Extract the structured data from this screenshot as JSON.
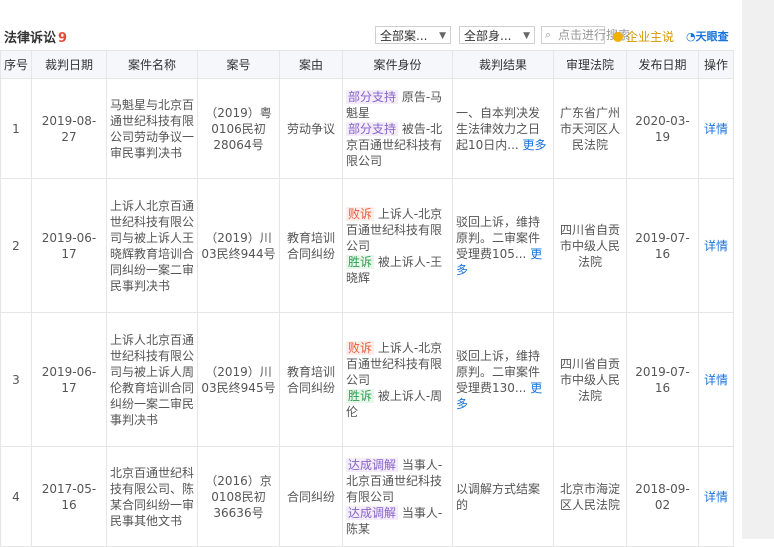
{
  "header": {
    "title": "法律诉讼",
    "count": "9",
    "filter_case": "全部案...",
    "filter_role": "全部身...",
    "search_placeholder": "点击进行搜索",
    "service": "企业主说",
    "brand": "天眼查"
  },
  "table": {
    "columns": [
      "序号",
      "裁判日期",
      "案件名称",
      "案号",
      "案由",
      "案件身份",
      "裁判结果",
      "审理法院",
      "发布日期",
      "操作"
    ],
    "more_label": "更多",
    "detail_label": "详情",
    "rows": [
      {
        "no": "1",
        "judge_date": "2019-08-27",
        "case_name": "马魁星与北京百通世纪科技有限公司劳动争议一审民事判决书",
        "case_no": "（2019）粤0106民初28064号",
        "cause": "劳动争议",
        "roles": [
          {
            "tag": "部分支持",
            "tag_type": "partial",
            "text": "原告-马魁星"
          },
          {
            "tag": "部分支持",
            "tag_type": "partial",
            "text": "被告-北京百通世纪科技有限公司"
          }
        ],
        "result": "一、自本判决发生法律效力之日起10日内...",
        "court": "广东省广州市天河区人民法院",
        "publish_date": "2020-03-19"
      },
      {
        "no": "2",
        "judge_date": "2019-06-17",
        "case_name": "上诉人北京百通世纪科技有限公司与被上诉人王晓辉教育培训合同纠纷一案二审民事判决书",
        "case_no": "（2019）川03民终944号",
        "cause": "教育培训合同纠纷",
        "roles": [
          {
            "tag": "败诉",
            "tag_type": "lose",
            "text": "上诉人-北京百通世纪科技有限公司"
          },
          {
            "tag": "胜诉",
            "tag_type": "win",
            "text": "被上诉人-王晓辉"
          }
        ],
        "result": "驳回上诉，维持原判。二审案件受理费105...",
        "court": "四川省自贡市中级人民法院",
        "publish_date": "2019-07-16"
      },
      {
        "no": "3",
        "judge_date": "2019-06-17",
        "case_name": "上诉人北京百通世纪科技有限公司与被上诉人周伦教育培训合同纠纷一案二审民事判决书",
        "case_no": "（2019）川03民终945号",
        "cause": "教育培训合同纠纷",
        "roles": [
          {
            "tag": "败诉",
            "tag_type": "lose",
            "text": "上诉人-北京百通世纪科技有限公司"
          },
          {
            "tag": "胜诉",
            "tag_type": "win",
            "text": "被上诉人-周伦"
          }
        ],
        "result": "驳回上诉，维持原判。二审案件受理费130...",
        "court": "四川省自贡市中级人民法院",
        "publish_date": "2019-07-16"
      },
      {
        "no": "4",
        "judge_date": "2017-05-16",
        "case_name": "北京百通世纪科技有限公司、陈某合同纠纷一审民事其他文书",
        "case_no": "（2016）京0108民初36636号",
        "cause": "合同纠纷",
        "roles": [
          {
            "tag": "达成调解",
            "tag_type": "med",
            "text": "当事人-北京百通世纪科技有限公司"
          },
          {
            "tag": "达成调解",
            "tag_type": "med",
            "text": "当事人-陈某"
          }
        ],
        "result": "以调解方式结案的",
        "court": "北京市海淀区人民法院",
        "publish_date": "2018-09-02"
      }
    ]
  }
}
